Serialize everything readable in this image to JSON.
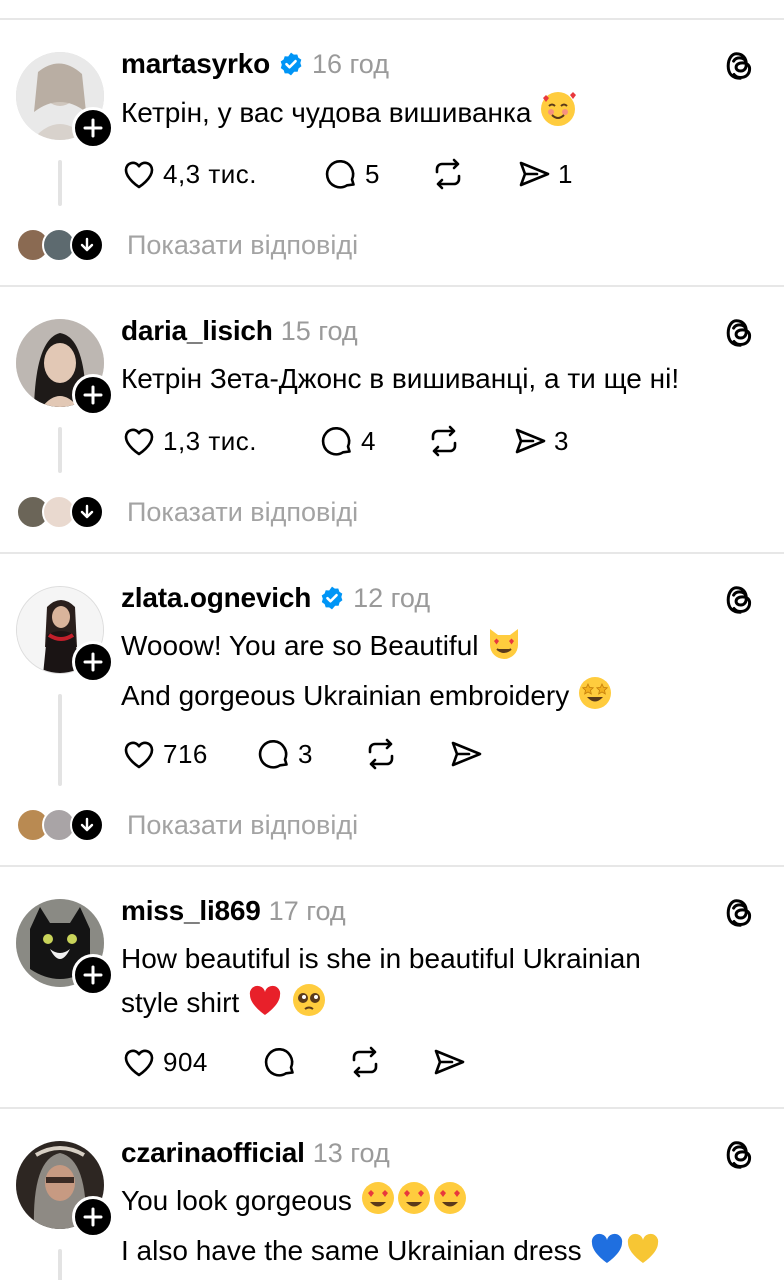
{
  "show_replies_label": "Показати відповіді",
  "posts": [
    {
      "username": "martasyrko",
      "verified": true,
      "time": "16 год",
      "lines": [
        "Кетрін, у вас чудова вишиванка"
      ],
      "likes": "4,3 тис.",
      "comments": "5",
      "reposts": "",
      "shares": "1",
      "has_replies": true
    },
    {
      "username": "daria_lisich",
      "verified": false,
      "time": "15 год",
      "lines": [
        "Кетрін Зета-Джонс в вишиванці, а ти ще ні!"
      ],
      "likes": "1,3 тис.",
      "comments": "4",
      "reposts": "",
      "shares": "3",
      "has_replies": true
    },
    {
      "username": "zlata.ognevich",
      "verified": true,
      "time": "12 год",
      "lines": [
        "Wooow! You are so Beautiful",
        "And gorgeous Ukrainian embroidery"
      ],
      "likes": "716",
      "comments": "3",
      "reposts": "",
      "shares": "",
      "has_replies": true
    },
    {
      "username": "miss_li869",
      "verified": false,
      "time": "17 год",
      "lines": [
        "How beautiful is she in beautiful Ukrainian",
        "style shirt"
      ],
      "likes": "904",
      "comments": "",
      "reposts": "",
      "shares": "",
      "has_replies": false
    },
    {
      "username": "czarinaofficial",
      "verified": false,
      "time": "13 год",
      "lines": [
        "You look gorgeous",
        "I also have the same Ukrainian dress"
      ],
      "likes": "",
      "comments": "",
      "reposts": "",
      "shares": "",
      "has_replies": false
    }
  ],
  "icons": {
    "like": "heart-outline-icon",
    "comment": "speech-bubble-icon",
    "repost": "repost-arrows-icon",
    "share": "paper-plane-icon",
    "threads": "threads-logo-icon",
    "verified": "verified-badge-icon",
    "follow": "plus-icon"
  },
  "colors": {
    "verified_blue": "#0095f6",
    "muted_text": "#9a9a9a",
    "divider": "#e7e7e7"
  }
}
